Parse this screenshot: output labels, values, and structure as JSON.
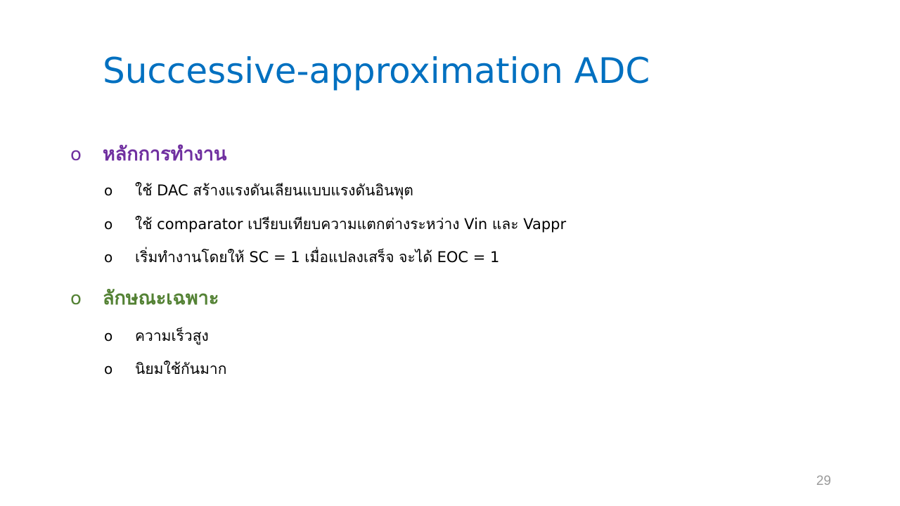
{
  "slide": {
    "title": "Successive-approximation ADC",
    "sections": [
      {
        "bullet": "o",
        "heading": "หลักการทำงาน",
        "items": [
          {
            "bullet": "o",
            "text": "ใช้ DAC สร้างแรงดันเลียนแบบแรงดันอินพุต"
          },
          {
            "bullet": "o",
            "text": "ใช้ comparator เปรียบเทียบความแตกต่างระหว่าง Vin และ Vappr"
          },
          {
            "bullet": "o",
            "text": "เริ่มทำงานโดยให้  SC = 1 เมื่อแปลงเสร็จ จะได้ EOC = 1"
          }
        ]
      },
      {
        "bullet": "o",
        "heading": "ลักษณะเฉพาะ",
        "items": [
          {
            "bullet": "o",
            "text": "ความเร็วสูง"
          },
          {
            "bullet": "o",
            "text": "นิยมใช้กันมาก"
          }
        ]
      }
    ],
    "page_number": "29"
  },
  "colors": {
    "title": "#0070C0",
    "section_1": "#7030A0",
    "section_2": "#548235",
    "page_number": "#9B9B9B"
  }
}
